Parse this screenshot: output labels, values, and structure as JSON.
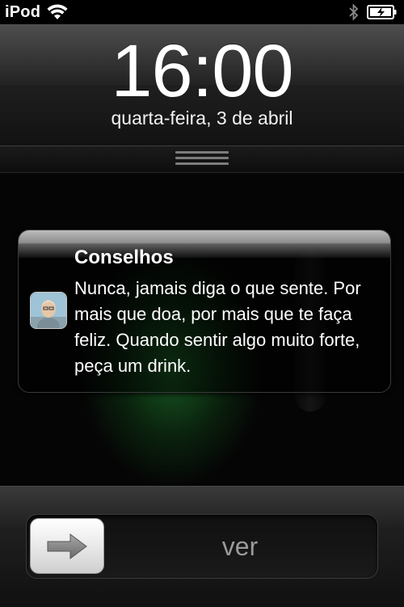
{
  "status_bar": {
    "carrier": "iPod",
    "icons": {
      "wifi": "wifi-icon",
      "bluetooth": "bluetooth-icon",
      "battery": "battery-charging-icon"
    }
  },
  "lock": {
    "time": "16:00",
    "date": "quarta-feira, 3 de abril"
  },
  "notification": {
    "app_icon": "app-icon-portrait",
    "title": "Conselhos",
    "body": "Nunca, jamais diga o que sente. Por mais que doa, por mais que te faça feliz. Quando sentir algo muito forte, peça um drink."
  },
  "slider": {
    "label": "ver",
    "knob_icon": "arrow-right-icon"
  },
  "colors": {
    "background": "#000000",
    "glow_green": "#2aa03c",
    "slider_text": "#9a9a9a"
  }
}
